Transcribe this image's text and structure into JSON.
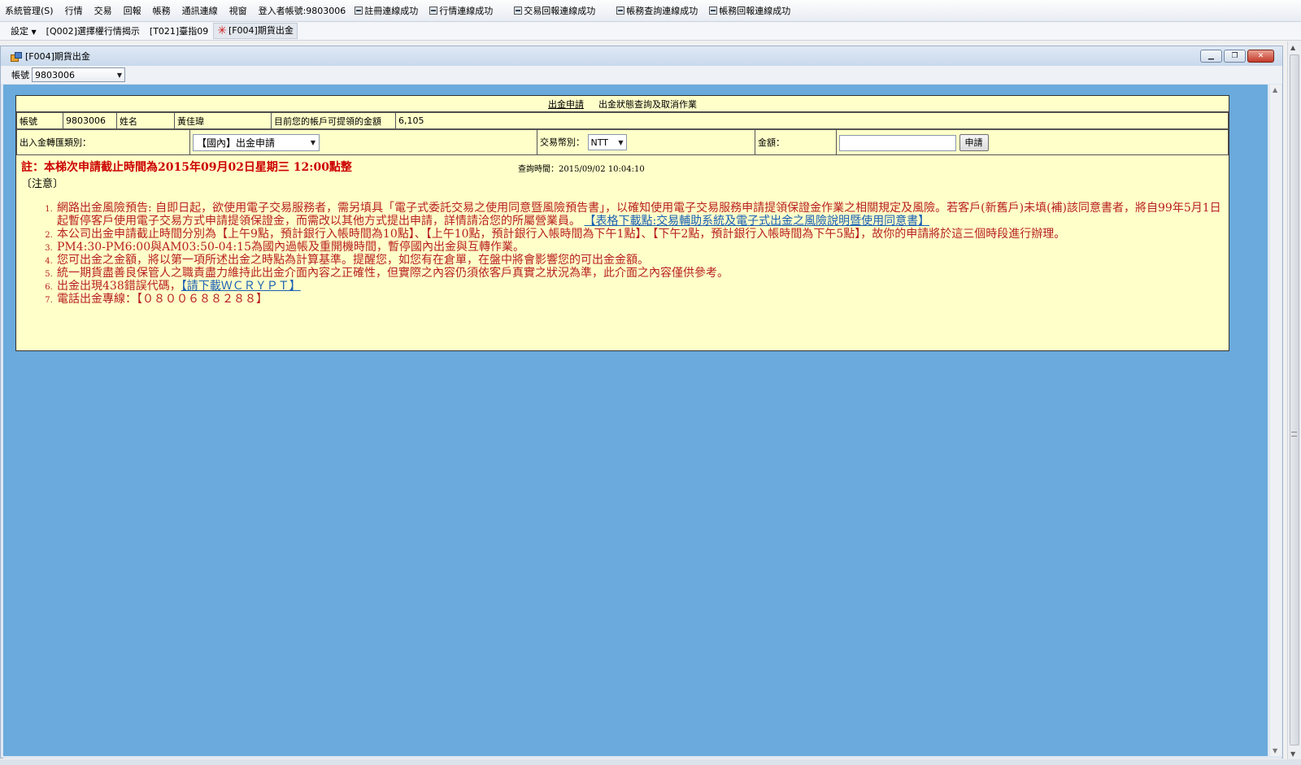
{
  "menubar": {
    "items": [
      "系統管理(S)",
      "行情",
      "交易",
      "回報",
      "帳務",
      "通訊連線",
      "視窗"
    ],
    "login": "登入者帳號:9803006",
    "statuses": [
      "註冊連線成功",
      "行情連線成功",
      "交易回報連線成功",
      "帳務查詢連線成功",
      "帳務回報連線成功"
    ]
  },
  "toolbar": {
    "settings": "設定",
    "items": [
      "[Q002]選擇權行情揭示",
      "[T021]臺指09",
      "[F004]期貨出金"
    ]
  },
  "window": {
    "title": "[F004]期貨出金",
    "account_label": "帳號",
    "account_value": "9803006"
  },
  "panel": {
    "tabs": [
      "出金申請",
      "出金狀態查詢及取消作業"
    ],
    "info": {
      "account_label": "帳號",
      "account": "9803006",
      "name_label": "姓名",
      "name": "黃佳瑋",
      "withdrawable_label": "目前您的帳戶可提領的金額",
      "withdrawable": "6,105"
    },
    "request": {
      "type_label": "出入金轉匯類別：",
      "type_value": "【國內】出金申請",
      "currency_label": "交易幣別：",
      "currency_value": "NTT",
      "amount_label": "金額：",
      "amount_value": "",
      "apply_button": "申請"
    },
    "deadline": "註：本梯次申請截止時間為2015年09月02日星期三 12:00點整",
    "query_time": "查詢時間：2015/09/02 10:04:10",
    "caution": "〔注意〕",
    "notes": [
      {
        "text": "網路出金風險預告: 自即日起，欲使用電子交易服務者，需另填具「電子式委託交易之使用同意暨風險預告書」，以確知使用電子交易服務申請提領保證金作業之相關規定及風險。若客戶(新舊戶)未填(補)該同意書者，將自99年5月1日起暫停客戶使用電子交易方式申請提領保證金，而需改以其他方式提出申請，詳情請洽您的所屬營業員。",
        "link": "【表格下載點:交易輔助系統及電子式出金之風險說明暨使用同意書】"
      },
      {
        "text": "本公司出金申請截止時間分別為【上午9點，預計銀行入帳時間為10點】、【上午10點，預計銀行入帳時間為下午1點】、【下午2點，預計銀行入帳時間為下午5點】，故你的申請將於這三個時段進行辦理。"
      },
      {
        "text": "PM4:30-PM6:00與AM03:50-04:15為國內過帳及重開機時間，暫停國內出金與互轉作業。"
      },
      {
        "text": "您可出金之金額，將以第一項所述出金之時點為計算基準。提醒您，如您有在倉單，在盤中將會影響您的可出金金額。"
      },
      {
        "text": "統一期貨盡善良保管人之職責盡力維持此出金介面內容之正確性，但實際之內容仍須依客戶真實之狀況為準，此介面之內容僅供參考。"
      },
      {
        "text": "出金出現438錯誤代碼，",
        "link": "【請下載ＷＣＲＹＰＴ】"
      },
      {
        "text": "電話出金專線：【０８００６８８２８８】"
      }
    ]
  }
}
